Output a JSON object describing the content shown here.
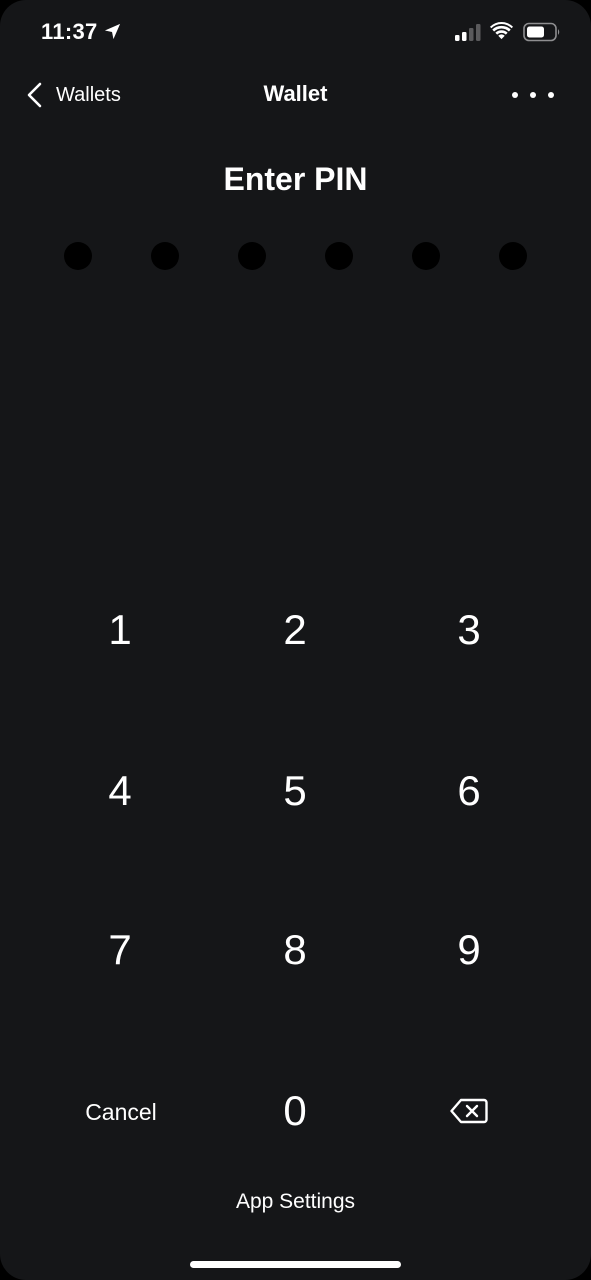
{
  "status_bar": {
    "time": "11:37",
    "icons": [
      "location-arrow-icon",
      "cellular-signal-icon",
      "wifi-icon",
      "battery-icon"
    ]
  },
  "nav": {
    "back_label": "Wallets",
    "title": "Wallet",
    "back_icon": "chevron-left-icon",
    "more_icon": "more-dots-icon"
  },
  "pin": {
    "title": "Enter PIN",
    "length": 6,
    "entered": 0
  },
  "keypad": {
    "k1": "1",
    "k2": "2",
    "k3": "3",
    "k4": "4",
    "k5": "5",
    "k6": "6",
    "k7": "7",
    "k8": "8",
    "k9": "9",
    "cancel": "Cancel",
    "k0": "0",
    "delete_icon": "backspace-icon"
  },
  "footer": {
    "app_settings": "App Settings"
  },
  "colors": {
    "background": "#151618",
    "text": "#ffffff",
    "pin_dot": "#000000"
  }
}
